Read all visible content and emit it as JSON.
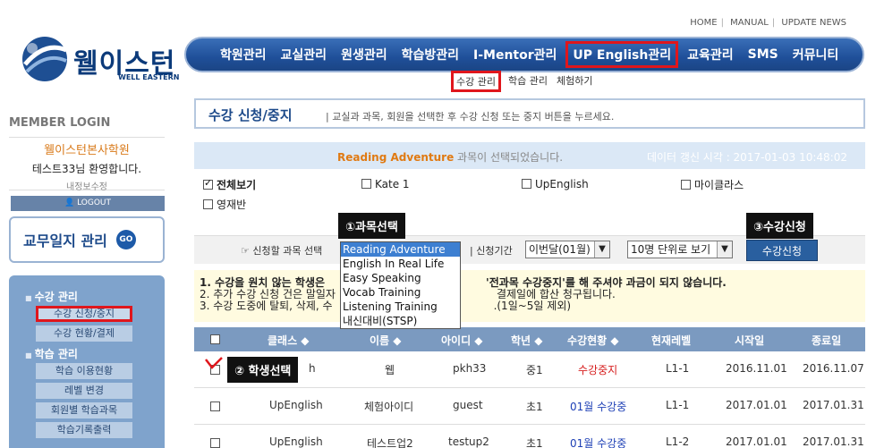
{
  "top_links": [
    "HOME",
    "MANUAL",
    "UPDATE NEWS"
  ],
  "logo": {
    "text": "웰이스턴",
    "sub": "WELL EASTERN"
  },
  "main_nav": [
    {
      "label": "학원관리",
      "active": false
    },
    {
      "label": "교실관리",
      "active": false
    },
    {
      "label": "원생관리",
      "active": false
    },
    {
      "label": "학습방관리",
      "active": false
    },
    {
      "label": "I-Mentor관리",
      "active": false
    },
    {
      "label": "UP English관리",
      "active": true
    },
    {
      "label": "교육관리",
      "active": false
    },
    {
      "label": "SMS",
      "active": false
    },
    {
      "label": "커뮤니티",
      "active": false
    }
  ],
  "sub_nav": [
    {
      "label": "수강 관리",
      "active": true
    },
    {
      "label": "학습 관리",
      "active": false
    },
    {
      "label": "체험하기",
      "active": false
    }
  ],
  "sidebar": {
    "member_login": "MEMBER LOGIN",
    "school": "웰이스턴본사학원",
    "welcome": "테스트33님 환영합니다.",
    "edit_info": "내정보수정",
    "logout": "LOGOUT",
    "journal": "교무일지 관리",
    "journal_go": "GO",
    "sections": [
      {
        "title": "수강 관리",
        "items": [
          {
            "label": "수강 신청/중지",
            "active": true
          },
          {
            "label": "수강 현황/결제",
            "active": false
          }
        ]
      },
      {
        "title": "학습 관리",
        "items": [
          {
            "label": "학습 이용현황",
            "active": false
          },
          {
            "label": "레벨 변경",
            "active": false
          },
          {
            "label": "회원별 학습과목",
            "active": false
          },
          {
            "label": "학습기록출력",
            "active": false
          }
        ]
      }
    ]
  },
  "page": {
    "title": "수강 신청/중지",
    "description": "교실과 과목, 회원을 선택한 후 수강 신청 또는 중지 버튼을 누르세요.",
    "selected_course": "Reading Adventure",
    "selected_msg_suffix": "과목이 선택되었습니다.",
    "update_time": "데이터 갱신 시각 : 2017-01-03 10:48:02"
  },
  "filters": [
    {
      "label": "전체보기",
      "checked": true,
      "bold": true
    },
    {
      "label": "Kate 1",
      "checked": false
    },
    {
      "label": "UpEnglish",
      "checked": false
    },
    {
      "label": "마이클라스",
      "checked": false
    },
    {
      "label": "영재반",
      "checked": false
    }
  ],
  "controls": {
    "course_label": "신청할 과목 선택",
    "period_label": "신청기간",
    "period_value": "이번달(01월)",
    "page_size": "10명 단위로 보기",
    "apply_button": "수강신청"
  },
  "course_options": [
    "Reading Adventure",
    "English In Real Life",
    "Easy Speaking",
    "Vocab Training",
    "Listening Training",
    "내신대비(STSP)"
  ],
  "notice": [
    "1. 수강을 원치 않는 학생은",
    "'전과목 수강중지'를 해 주셔야 과금이 되지 않습니다.",
    "2. 추가 수강 신청 건은 말일자",
    "결제일에 합산 청구됩니다.",
    "3. 수강 도중에 탈퇴, 삭제, 수",
    ".(1일~5일 제외)"
  ],
  "table": {
    "headers": [
      "클래스 ◆",
      "이름 ◆",
      "아이디 ◆",
      "학년 ◆",
      "수강현황 ◆",
      "현재레벨",
      "시작일",
      "종료일"
    ],
    "rows": [
      {
        "class": "h",
        "name": "웹",
        "id": "pkh33",
        "grade": "중1",
        "status": "수강중지",
        "status_color": "red",
        "level": "L1-1",
        "start": "2016.11.01",
        "end": "2016.11.07"
      },
      {
        "class": "UpEnglish",
        "name": "체험아이디",
        "id": "guest",
        "grade": "초1",
        "status": "01월 수강중",
        "status_color": "blue",
        "level": "L1-1",
        "start": "2017.01.01",
        "end": "2017.01.31"
      },
      {
        "class": "UpEnglish",
        "name": "테스트업2",
        "id": "testup2",
        "grade": "초1",
        "status": "01월 수강중",
        "status_color": "blue",
        "level": "L1-2",
        "start": "2017.01.01",
        "end": "2017.01.31"
      }
    ]
  },
  "callouts": {
    "step1": "①과목선택",
    "step2": "② 학생선택",
    "step3": "③수강신청"
  },
  "colors": {
    "nav": "#1f4f99",
    "highlight": "#e0161c",
    "course": "#e07a13",
    "status_stop": "#d61d1d",
    "status_active": "#1d3fb5"
  }
}
